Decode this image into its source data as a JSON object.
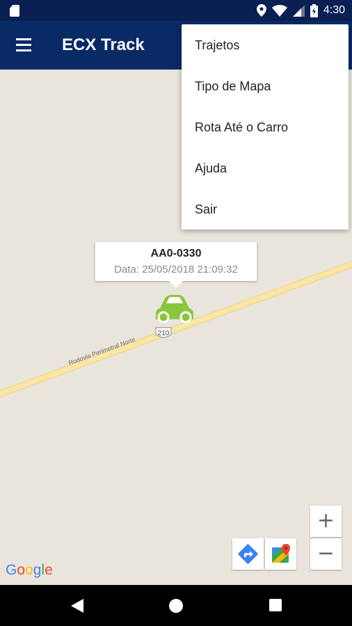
{
  "status_bar": {
    "time": "4:30"
  },
  "app_bar": {
    "title": "ECX Track"
  },
  "overflow_menu": {
    "items": [
      {
        "label": "Trajetos"
      },
      {
        "label": "Tipo de Mapa"
      },
      {
        "label": "Rota Até o Carro"
      },
      {
        "label": "Ajuda"
      },
      {
        "label": "Sair"
      }
    ]
  },
  "map": {
    "road_name": "Rodovia Perimetral Norte",
    "road_shield": "210",
    "vehicle": {
      "plate": "AA0-0330",
      "date": "Data: 25/05/2018 21:09:32",
      "color": "#8cc63f"
    },
    "zoom_in": "+",
    "zoom_out": "−",
    "attribution": {
      "G": "G",
      "o1": "o",
      "o2": "o",
      "g": "g",
      "l": "l",
      "e": "e"
    }
  },
  "colors": {
    "app_bar": "#0a2a66",
    "status_bar": "#0a1f52",
    "map_bg": "#e9e5dc",
    "road": "#f7e3a1"
  },
  "icons": {
    "status": [
      "sd-card-icon",
      "location-icon",
      "wifi-icon",
      "signal-icon",
      "battery-icon"
    ],
    "map_tools": [
      "directions-icon",
      "google-maps-icon"
    ],
    "nav": [
      "back-icon",
      "home-icon",
      "recents-icon"
    ]
  }
}
